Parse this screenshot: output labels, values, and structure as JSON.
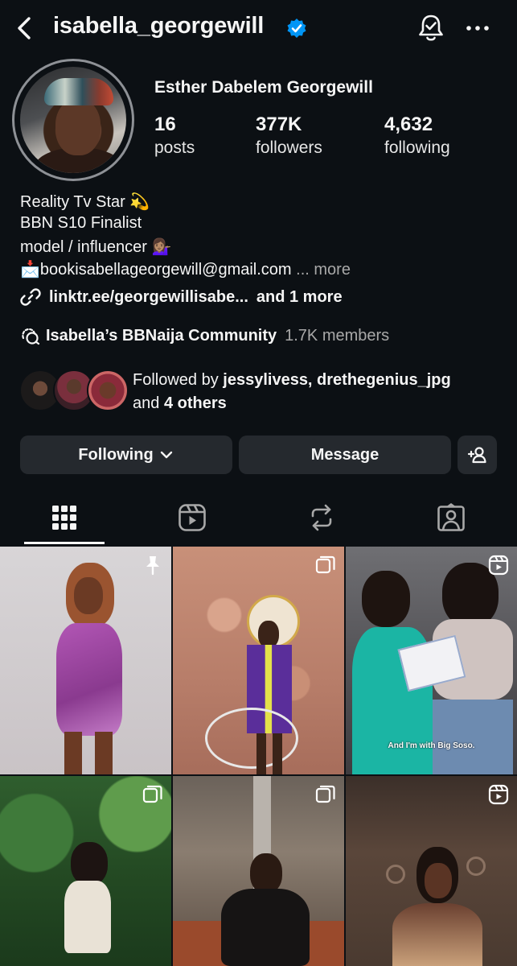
{
  "header": {
    "username": "isabella_georgewill",
    "icons": [
      "back-chevron-icon",
      "verified-badge-icon",
      "notification-bell-icon",
      "more-dots-icon"
    ]
  },
  "profile": {
    "full_name": "Esther Dabelem Georgewill",
    "stats": [
      {
        "value": "16",
        "label": "posts"
      },
      {
        "value": "377K",
        "label": "followers"
      },
      {
        "value": "4,632",
        "label": "following"
      }
    ],
    "bio_lines": [
      {
        "text": "Reality Tv Star",
        "emoji": "💫"
      },
      {
        "text": "BBN S10 Finalist",
        "emoji": ""
      },
      {
        "text": "model / influencer",
        "emoji": "💁🏽‍♀️"
      }
    ],
    "email_emoji": "📩",
    "email": "bookisabellageorgewill@gmail.com",
    "more_label": "... more",
    "link": "linktr.ee/georgewillisabe...",
    "link_more": "and 1 more",
    "community_name": "Isabella’s BBNaija Community",
    "community_members": "1.7K members",
    "followed_by_prefix": "Followed by",
    "followed_by_names": "jessylivess, drethegenius_jpg",
    "followed_by_and": "and",
    "followed_by_others": "4 others"
  },
  "actions": {
    "following_label": "Following",
    "message_label": "Message"
  },
  "tabs": [
    "grid-icon",
    "reels-icon",
    "reposts-icon",
    "tagged-icon"
  ],
  "grid": {
    "posts": [
      {
        "type": "pinned"
      },
      {
        "type": "carousel"
      },
      {
        "type": "reel",
        "caption": "And I'm with Big Soso."
      },
      {
        "type": "carousel"
      },
      {
        "type": "carousel"
      },
      {
        "type": "reel"
      }
    ]
  },
  "colors": {
    "background": "#0c1014",
    "verified": "#0095f6",
    "button": "#25292e",
    "secondary_text": "#a8a8a8"
  }
}
